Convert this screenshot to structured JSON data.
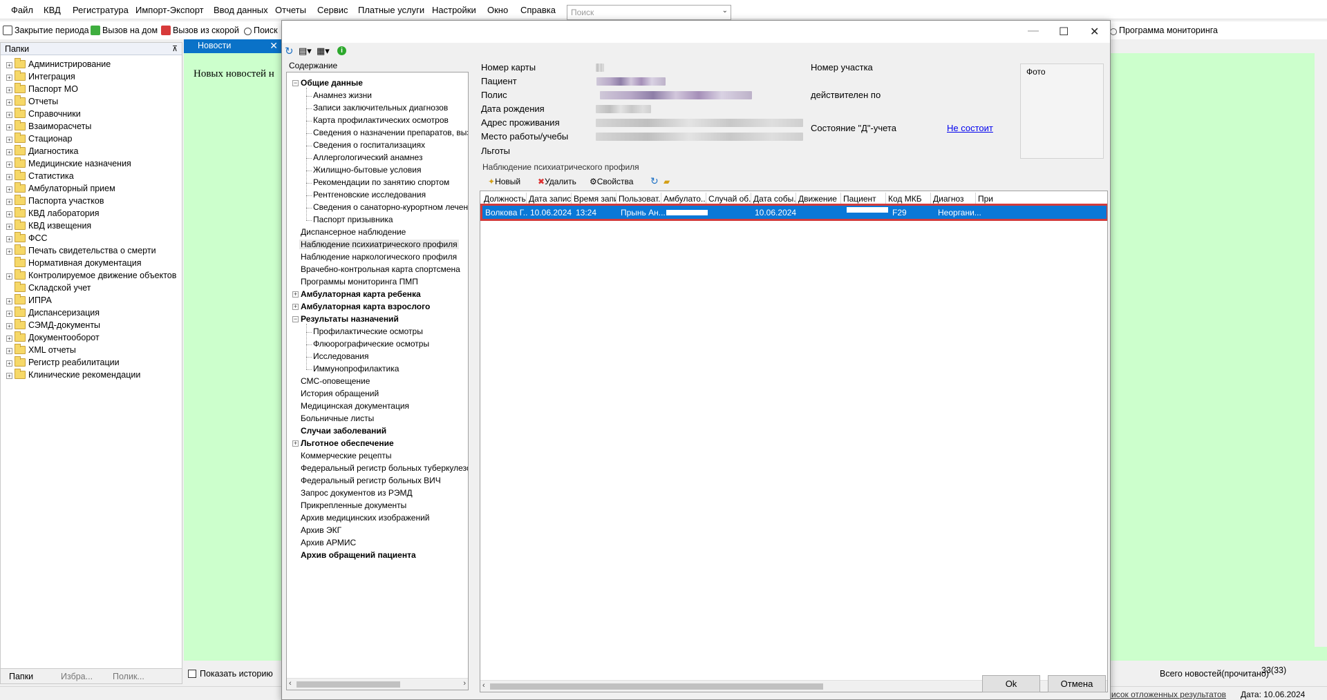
{
  "menubar": {
    "items": [
      "Файл",
      "КВД",
      "Регистратура",
      "Импорт-Экспорт",
      "Ввод данных",
      "Отчеты",
      "Сервис",
      "Платные услуги",
      "Настройки",
      "Окно",
      "Справка"
    ],
    "search_placeholder": "Поиск"
  },
  "toolbar": {
    "close_period": "Закрытие периода",
    "home_call": "Вызов на дом",
    "ambulance_call": "Вызов из скорой",
    "search": "Поиск",
    "monitoring": "Программа мониторинга"
  },
  "left_panel": {
    "title": "Папки",
    "folders": [
      "Администрирование",
      "Интеграция",
      "Паспорт МО",
      "Отчеты",
      "Справочники",
      "Взаиморасчеты",
      "Стационар",
      "Диагностика",
      "Медицинские назначения",
      "Статистика",
      "Амбулаторный прием",
      "Паспорта участков",
      "КВД лаборатория",
      "КВД извещения",
      "ФСС",
      "Печать свидетельства о смерти",
      "Нормативная документация",
      "Контролируемое движение объектов",
      "Складской учет",
      "ИПРА",
      "Диспансеризация",
      "СЭМД-документы",
      "Документооборот",
      "XML отчеты",
      "Регистр реабилитации",
      "Клинические рекомендации"
    ],
    "tabs": [
      "Папки",
      "Избра...",
      "Полик..."
    ]
  },
  "news": {
    "tab": "Новости",
    "text": "Новых новостей н",
    "show_history": "Показать историю",
    "total_label": "Всего новостей(прочитано)",
    "total_value": "33(33)"
  },
  "statusbar": {
    "deferred": "Список отложенных результатов",
    "date": "Дата: 10.06.2024"
  },
  "dialog": {
    "content_label": "Содержание",
    "tree": [
      {
        "label": "Общие данные",
        "bold": true,
        "level": 0,
        "exp": "−"
      },
      {
        "label": "Анамнез жизни",
        "level": 1
      },
      {
        "label": "Записи заключительных диагнозов",
        "level": 1
      },
      {
        "label": "Карта профилактических осмотров",
        "level": 1
      },
      {
        "label": "Сведения о назначении препаратов, вызывающих зависимость",
        "level": 1
      },
      {
        "label": "Сведения о госпитализациях",
        "level": 1
      },
      {
        "label": "Аллергологический анамнез",
        "level": 1
      },
      {
        "label": "Жилищно-бытовые условия",
        "level": 1
      },
      {
        "label": "Рекомендации по занятию спортом",
        "level": 1
      },
      {
        "label": "Рентгеновские исследования",
        "level": 1
      },
      {
        "label": "Сведения о санаторно-курортном лечении",
        "level": 1
      },
      {
        "label": "Паспорт призывника",
        "level": 1
      },
      {
        "label": "Диспансерное наблюдение",
        "level": 0
      },
      {
        "label": "Наблюдение психиатрического профиля",
        "level": 0,
        "selected": true
      },
      {
        "label": "Наблюдение наркологического профиля",
        "level": 0
      },
      {
        "label": "Врачебно-контрольная карта спортсмена",
        "level": 0
      },
      {
        "label": "Программы мониторинга ПМП",
        "level": 0
      },
      {
        "label": "Амбулаторная карта ребенка",
        "bold": true,
        "level": 0,
        "exp": "+"
      },
      {
        "label": "Амбулаторная карта взрослого",
        "bold": true,
        "level": 0,
        "exp": "+"
      },
      {
        "label": "Результаты назначений",
        "bold": true,
        "level": 0,
        "exp": "−"
      },
      {
        "label": "Профилактические осмотры",
        "level": 1
      },
      {
        "label": "Флюорографические осмотры",
        "level": 1
      },
      {
        "label": "Исследования",
        "level": 1
      },
      {
        "label": "Иммунопрофилактика",
        "level": 1
      },
      {
        "label": "СМС-оповещение",
        "level": 0
      },
      {
        "label": "История обращений",
        "level": 0
      },
      {
        "label": "Медицинская документация",
        "level": 0
      },
      {
        "label": "Больничные листы",
        "level": 0
      },
      {
        "label": "Случаи заболеваний",
        "bold": true,
        "level": 0
      },
      {
        "label": "Льготное обеспечение",
        "bold": true,
        "level": 0,
        "exp": "+"
      },
      {
        "label": "Коммерческие рецепты",
        "level": 0
      },
      {
        "label": "Федеральный регистр больных туберкулезом",
        "level": 0
      },
      {
        "label": "Федеральный регистр больных ВИЧ",
        "level": 0
      },
      {
        "label": "Запрос документов из РЭМД",
        "level": 0
      },
      {
        "label": "Прикрепленные документы",
        "level": 0
      },
      {
        "label": "Архив медицинских изображений",
        "level": 0
      },
      {
        "label": "Архив ЭКГ",
        "level": 0
      },
      {
        "label": "Архив АРМИС",
        "level": 0
      },
      {
        "label": "Архив обращений пациента",
        "bold": true,
        "level": 0
      }
    ],
    "info": {
      "card_number": "Номер карты",
      "patient": "Пациент",
      "policy": "Полис",
      "birth_date": "Дата рождения",
      "address": "Адрес проживания",
      "workplace": "Место работы/учебы",
      "benefits": "Льготы",
      "district": "Номер участка",
      "valid_until": "действителен по",
      "d_status": "Состояние \"Д\"-учета",
      "d_status_value": "Не состоит",
      "photo": "Фото"
    },
    "section_title": "Наблюдение психиатрического профиля",
    "sub_toolbar": {
      "new": "Новый",
      "delete": "Удалить",
      "properties": "Свойства"
    },
    "grid": {
      "columns": [
        "Должность",
        "Дата записи",
        "Время запи...",
        "Пользоват...",
        "Амбулато...",
        "Случай об...",
        "Дата собы...",
        "Движение",
        "Пациент",
        "Код МКБ",
        "Диагноз",
        "При"
      ],
      "rows": [
        {
          "position": "Волкова Г....",
          "record_date": "10.06.2024",
          "record_time": "13:24",
          "user": "Прынь Ан...",
          "event_date": "10.06.2024",
          "mkb": "F29",
          "diagnosis": "Неоргани..."
        }
      ]
    },
    "buttons": {
      "ok": "Ok",
      "cancel": "Отмена"
    }
  },
  "colors": {
    "accent": "#0a78d7",
    "news_bg": "#ccffcc",
    "highlight": "#d33b3b",
    "link": "#0000ee"
  }
}
